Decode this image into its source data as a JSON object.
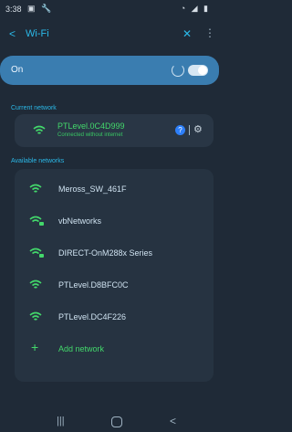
{
  "status_bar": {
    "time": "3:38"
  },
  "app_bar": {
    "title": "Wi-Fi"
  },
  "toggle": {
    "label": "On",
    "state": "on"
  },
  "current_section": {
    "label": "Current network"
  },
  "current_network": {
    "ssid": "PTLevel.0C4D999",
    "status": "Connected without internet",
    "info_glyph": "?"
  },
  "available_section": {
    "label": "Available networks"
  },
  "available_networks": [
    {
      "ssid": "Meross_SW_461F",
      "secured": false
    },
    {
      "ssid": "vbNetworks",
      "secured": true
    },
    {
      "ssid": "DIRECT-OnM288x Series",
      "secured": true
    },
    {
      "ssid": "PTLevel.D8BFC0C",
      "secured": false
    },
    {
      "ssid": "PTLevel.DC4F226",
      "secured": false
    }
  ],
  "add_network": {
    "label": "Add network"
  },
  "colors": {
    "background": "#1f2a37",
    "accent": "#2bb9e8",
    "wifi_green": "#43d86b",
    "toggle_card": "#3a7db0"
  },
  "icons": {
    "back": "arrow-back-icon",
    "scan": "qr-scan-icon",
    "more": "more-vert-icon",
    "wifi": "wifi-icon",
    "info": "info-icon",
    "settings": "gear-icon",
    "add": "plus-icon"
  }
}
